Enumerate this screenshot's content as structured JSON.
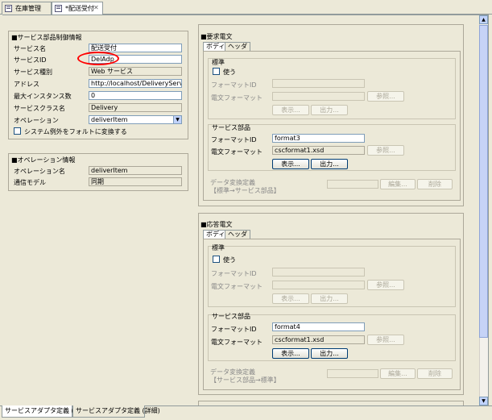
{
  "editor_tabs": [
    {
      "label": "在庫管理"
    },
    {
      "label": "*配送受付"
    }
  ],
  "control": {
    "title": "■サービス部品制御情報",
    "service_name_label": "サービス名",
    "service_name_value": "配送受付",
    "service_id_label": "サービスID",
    "service_id_value": "DelAdp",
    "service_type_label": "サービス種別",
    "service_type_value": "Web サービス",
    "address_label": "アドレス",
    "address_value": "http://localhost/DeliveryServiceWeb/s",
    "max_instances_label": "最大インスタンス数",
    "max_instances_value": "0",
    "class_name_label": "サービスクラス名",
    "class_name_value": "Delivery",
    "operation_label": "オペレーション",
    "operation_value": "deliverItem",
    "fault_checkbox_label": "システム例外をフォルトに変換する"
  },
  "operation_info": {
    "title": "■オペレーション情報",
    "name_label": "オペレーション名",
    "name_value": "deliverItem",
    "model_label": "通信モデル",
    "model_value": "同期"
  },
  "request": {
    "title": "■要求電文",
    "tab_body": "ボディ",
    "tab_header": "ヘッダ",
    "standard_title": "標準",
    "use_label": "使う",
    "format_id_label": "フォーマットID",
    "format_label": "電文フォーマット",
    "browse_label": "参照...",
    "show_label": "表示...",
    "output_label": "出力...",
    "parts_title": "サービス部品",
    "parts_format_id_value": "format3",
    "parts_format_value": "cscformat1.xsd",
    "conversion_line1": "データ変換定義",
    "conversion_line2": "【標準→サービス部品】",
    "edit_label": "編集...",
    "delete_label": "削除"
  },
  "response": {
    "title": "■応答電文",
    "tab_body": "ボディ",
    "tab_header": "ヘッダ",
    "standard_title": "標準",
    "use_label": "使う",
    "format_id_label": "フォーマットID",
    "format_label": "電文フォーマット",
    "browse_label": "参照...",
    "show_label": "表示...",
    "output_label": "出力...",
    "parts_title": "サービス部品",
    "parts_format_id_value": "format4",
    "parts_format_value": "cscformat1.xsd",
    "conversion_line1": "データ変換定義",
    "conversion_line2": "【サービス部品→標準】",
    "edit_label": "編集...",
    "delete_label": "削除"
  },
  "bottom_tabs": [
    {
      "label": "サービスアダプタ定義 (基本)"
    },
    {
      "label": "サービスアダプタ定義 (詳細)"
    }
  ],
  "colors": {
    "background": "#ece9d8",
    "annotation": "#ff0000",
    "field_border": "#7f9db9"
  },
  "icons": [
    "editor-icon",
    "close-icon",
    "checkbox-icon",
    "dropdown-arrow-icon",
    "scroll-up-arrow-icon",
    "scroll-down-arrow-icon"
  ]
}
